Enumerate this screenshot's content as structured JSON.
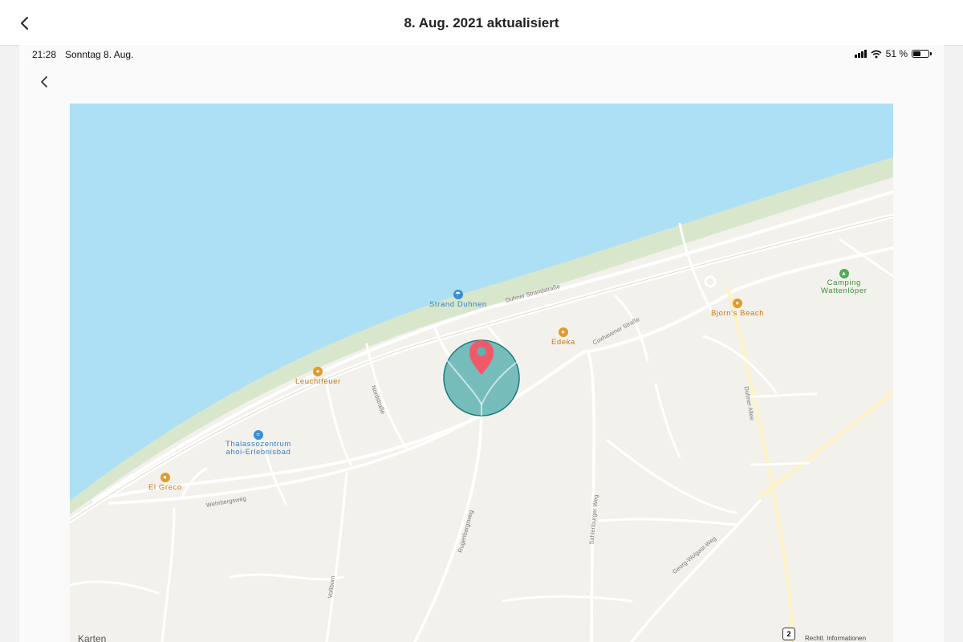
{
  "header": {
    "title": "8. Aug. 2021 aktualisiert",
    "back_icon": "chevron-left-icon"
  },
  "statusbar": {
    "time": "21:28",
    "date": "Sonntag 8. Aug.",
    "battery_text": "51 %",
    "battery_level": 0.51
  },
  "map": {
    "attribution": "Karten",
    "legal": "Rechtl. Informationen",
    "route_shield": "2",
    "pois": [
      {
        "name": "strand",
        "label": "Strand Duhnen",
        "color": "#3a8fd1",
        "glyph": "☂"
      },
      {
        "name": "edeka",
        "label": "Edeka",
        "color": "#e39a2c",
        "glyph": "●"
      },
      {
        "name": "bjorns-beach",
        "label": "Bjorn's Beach",
        "color": "#e39a2c",
        "glyph": "●"
      },
      {
        "name": "camping",
        "label": "Camping\nWattenlöper",
        "color": "#4caf50",
        "glyph": "▲"
      },
      {
        "name": "leuchtfeuer",
        "label": "Leuchtfeuer",
        "color": "#e39a2c",
        "glyph": "●"
      },
      {
        "name": "thalasso",
        "label": "Thalassozentrum\nahoi-Erlebnisbad",
        "color": "#3a8fd1",
        "glyph": "≈"
      },
      {
        "name": "el-greco",
        "label": "El Greco",
        "color": "#e39a2c",
        "glyph": "●"
      }
    ],
    "streets": {
      "duhner_strandstrasse": "Duhner Strandstraße",
      "cuxhavener_strasse": "Cuxhavener Straße",
      "nordstrasse": "Nordstraße",
      "wehrbergsweg": "Wehrbergsweg",
      "rugenbargsweg": "Rugenbargsweg",
      "sahlenburger_weg": "Sahlenburger Weg",
      "duhner_allee": "Duhner Allee",
      "vossborn": "Voßborn",
      "georg_wolgast_weg": "Georg-Wolgast-Weg"
    },
    "colors": {
      "water": "#aee0f5",
      "beach": "#cfe2c3",
      "land": "#f3f1ec",
      "road": "#ffffff",
      "circle": "#5fb3b3",
      "pin": "#f0596a"
    }
  }
}
